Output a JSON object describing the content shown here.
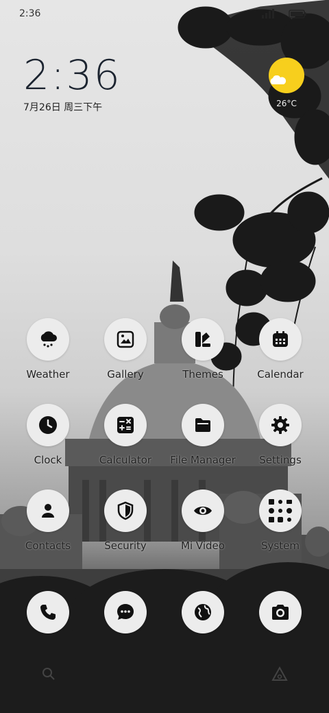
{
  "status_bar": {
    "time": "2:36"
  },
  "clock_widget": {
    "time": "2:36",
    "date": "7月26日 周三下午"
  },
  "weather_widget": {
    "temperature": "26°C",
    "icon": "sunny-cloud-icon"
  },
  "apps": [
    {
      "label": "Weather",
      "icon": "weather-icon"
    },
    {
      "label": "Gallery",
      "icon": "gallery-icon"
    },
    {
      "label": "Themes",
      "icon": "themes-icon"
    },
    {
      "label": "Calendar",
      "icon": "calendar-icon"
    },
    {
      "label": "Clock",
      "icon": "clock-icon"
    },
    {
      "label": "Calculator",
      "icon": "calculator-icon"
    },
    {
      "label": "File Manager",
      "icon": "folder-icon"
    },
    {
      "label": "Settings",
      "icon": "gear-icon"
    },
    {
      "label": "Contacts",
      "icon": "contacts-icon"
    },
    {
      "label": "Security",
      "icon": "shield-icon"
    },
    {
      "label": "Mi Video",
      "icon": "eye-icon"
    },
    {
      "label": "System",
      "icon": "app-folder-icon"
    }
  ],
  "dock": [
    {
      "icon": "phone-icon"
    },
    {
      "icon": "messages-icon"
    },
    {
      "icon": "browser-icon"
    },
    {
      "icon": "camera-icon"
    }
  ]
}
